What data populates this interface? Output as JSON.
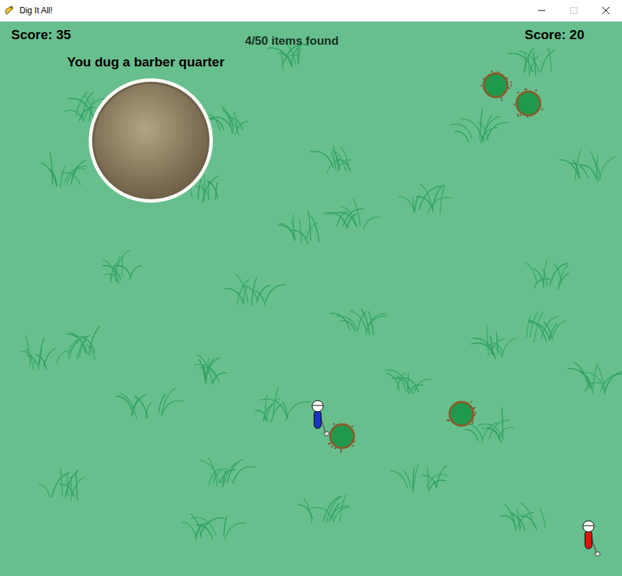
{
  "window": {
    "title": "Dig It All!"
  },
  "players": [
    {
      "score": "Score: 35",
      "color": "#1b33c8"
    },
    {
      "score": "Score: 20",
      "color": "#e0140c"
    }
  ],
  "progress": "4/50 items found",
  "message": "You dug a barber quarter"
}
